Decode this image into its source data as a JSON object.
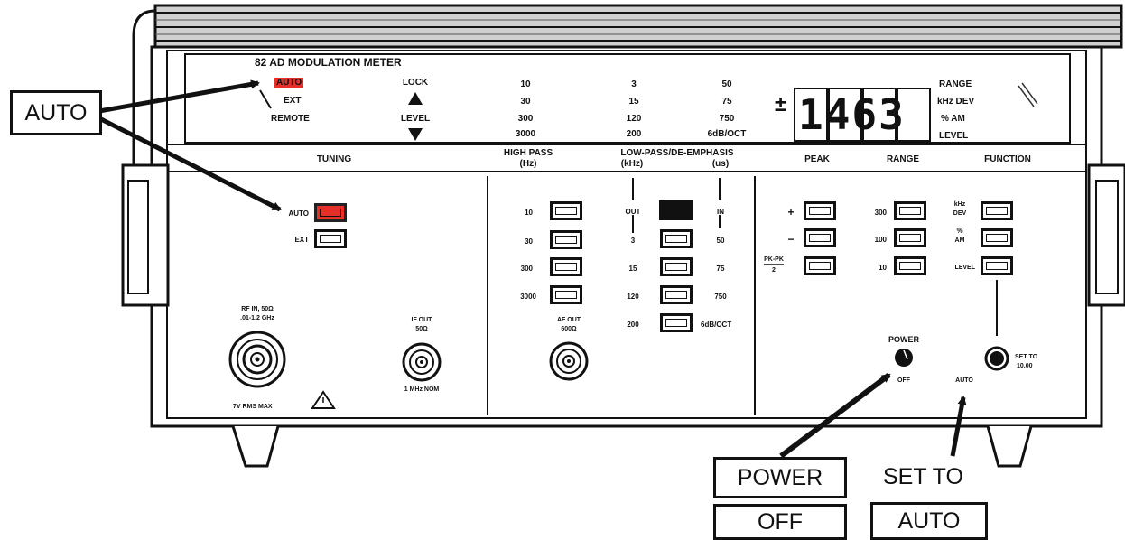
{
  "title": "82 AD MODULATION METER",
  "display": {
    "mode_labels": [
      "AUTO",
      "EXT",
      "REMOTE"
    ],
    "lock_label": "LOCK",
    "level_label": "LEVEL",
    "col1": [
      "10",
      "30",
      "300",
      "3000"
    ],
    "col2": [
      "3",
      "15",
      "120",
      "200"
    ],
    "col3": [
      "50",
      "75",
      "750",
      "6dB/OCT"
    ],
    "sign": "±",
    "readout": "1463",
    "units": [
      "RANGE",
      "kHz DEV",
      "% AM",
      "LEVEL"
    ]
  },
  "sections": {
    "tuning": "TUNING",
    "high_pass": "HIGH PASS",
    "high_pass_unit": "(Hz)",
    "low_pass": "LOW-PASS/DE-EMPHASIS",
    "low_pass_unit1": "(kHz)",
    "low_pass_unit2": "(us)",
    "peak": "PEAK",
    "range": "RANGE",
    "function": "FUNCTION"
  },
  "tuning": {
    "auto": "AUTO",
    "ext": "EXT"
  },
  "high_pass": [
    "10",
    "30",
    "300",
    "3000"
  ],
  "low_pass": {
    "out": "OUT",
    "in": "IN",
    "left": [
      "3",
      "15",
      "120",
      "200"
    ],
    "right": [
      "50",
      "75",
      "750",
      "6dB/OCT"
    ]
  },
  "peak": {
    "plus": "+",
    "minus": "−",
    "pkpk_top": "PK-PK",
    "pkpk_bottom": "2"
  },
  "range_buttons": [
    "300",
    "100",
    "10"
  ],
  "function": {
    "khz": "kHz",
    "dev": "DEV",
    "pct": "%",
    "am": "AM",
    "level": "LEVEL"
  },
  "connectors": {
    "rf_in_1": "RF IN, 50Ω",
    "rf_in_2": ".01-1.2 GHz",
    "rf_max": "7V RMS MAX",
    "if_out_1": "IF OUT",
    "if_out_2": "50Ω",
    "if_out_3": "1 MHz NOM",
    "af_out_1": "AF OUT",
    "af_out_2": "600Ω"
  },
  "power": {
    "label": "POWER",
    "off": "OFF",
    "auto": "AUTO",
    "set_to_1": "SET TO",
    "set_to_2": "10.00"
  },
  "callouts": {
    "auto": "AUTO",
    "power": "POWER",
    "off": "OFF",
    "set_to": "SET TO",
    "auto2": "AUTO"
  }
}
